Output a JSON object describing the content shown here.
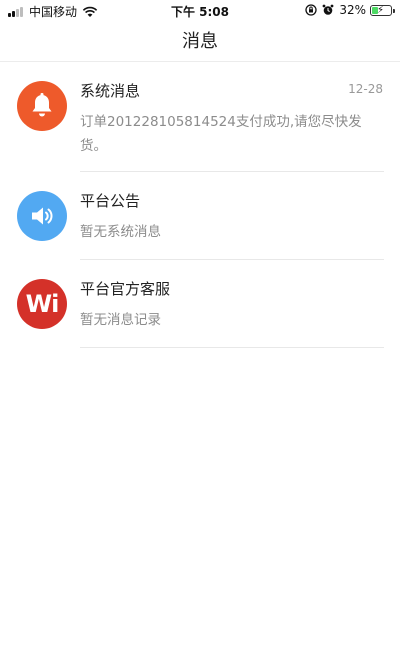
{
  "status_bar": {
    "carrier": "中国移动",
    "time": "下午 5:08",
    "battery_percent": "32%",
    "battery_level": 0.32,
    "icons": [
      "signal-icon",
      "wifi-icon",
      "screen-lock-icon",
      "alarm-icon",
      "battery-icon"
    ]
  },
  "header": {
    "title": "消息"
  },
  "messages": [
    {
      "title": "系统消息",
      "date": "12-28",
      "preview": "订单201228105814524支付成功,请您尽快发货。",
      "icon": "bell-icon",
      "color": "#ee5a2b"
    },
    {
      "title": "平台公告",
      "date": "",
      "preview": "暂无系统消息",
      "icon": "speaker-icon",
      "color": "#52a9f2"
    },
    {
      "title": "平台官方客服",
      "date": "",
      "preview": "暂无消息记录",
      "icon": "wi-logo-icon",
      "logo_text": "Wi",
      "color": "#d43129"
    }
  ]
}
